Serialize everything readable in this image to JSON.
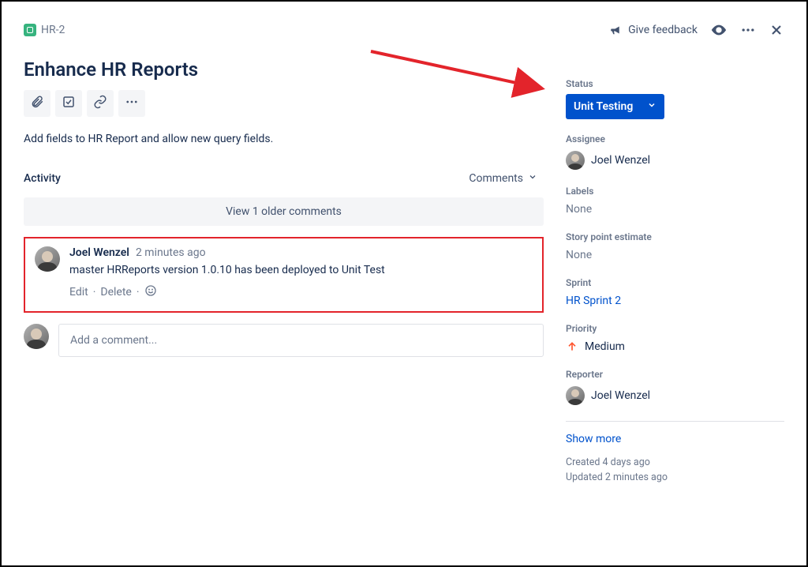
{
  "header": {
    "issue_key": "HR-2",
    "feedback_label": "Give feedback"
  },
  "issue": {
    "title": "Enhance HR Reports",
    "description": "Add fields to HR Report and allow new query fields."
  },
  "activity": {
    "label": "Activity",
    "filter_label": "Comments",
    "older_label": "View 1 older comments",
    "comment": {
      "author": "Joel Wenzel",
      "time": "2 minutes ago",
      "body": "master HRReports version 1.0.10 has been deployed to Unit Test",
      "edit_label": "Edit",
      "delete_label": "Delete"
    },
    "add_placeholder": "Add a comment..."
  },
  "side": {
    "status_label": "Status",
    "status_value": "Unit Testing",
    "assignee_label": "Assignee",
    "assignee_value": "Joel Wenzel",
    "labels_label": "Labels",
    "labels_value": "None",
    "story_label": "Story point estimate",
    "story_value": "None",
    "sprint_label": "Sprint",
    "sprint_value": "HR Sprint 2",
    "priority_label": "Priority",
    "priority_value": "Medium",
    "reporter_label": "Reporter",
    "reporter_value": "Joel Wenzel",
    "show_more": "Show more",
    "created": "Created 4 days ago",
    "updated": "Updated 2 minutes ago"
  }
}
